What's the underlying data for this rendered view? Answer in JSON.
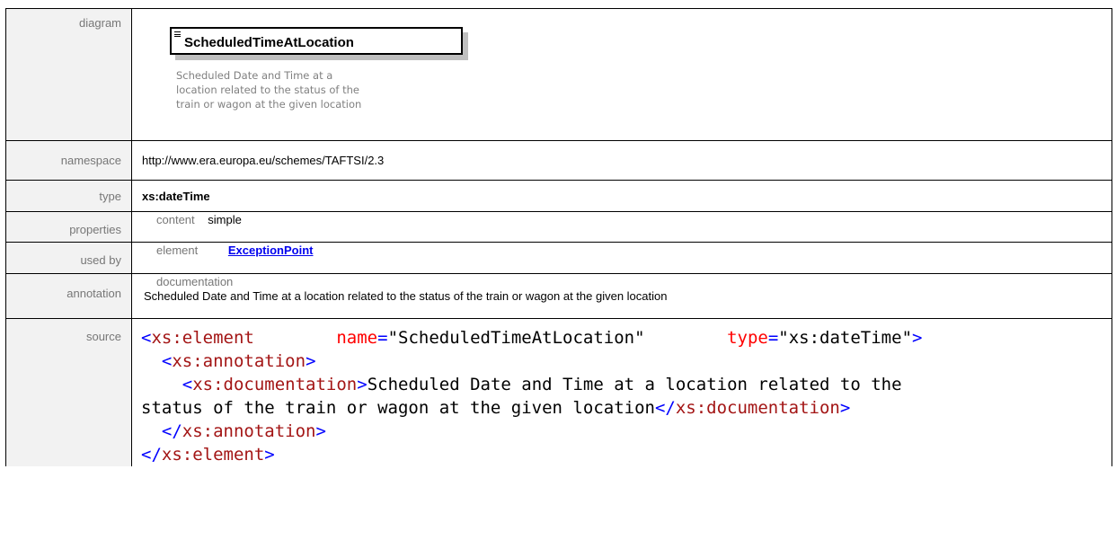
{
  "rows": {
    "diagram": {
      "label": "diagram",
      "element_name": "ScheduledTimeAtLocation",
      "doc_line1": "Scheduled Date and Time at a",
      "doc_line2": "location related to the status of the",
      "doc_line3": "train or wagon at the given location"
    },
    "namespace": {
      "label": "namespace",
      "value": "http://www.era.europa.eu/schemes/TAFTSI/2.3"
    },
    "type": {
      "label": "type",
      "value": "xs:dateTime"
    },
    "properties": {
      "label": "properties",
      "key": "content",
      "value": "simple"
    },
    "used_by": {
      "label": "used by",
      "key": "element",
      "link": "ExceptionPoint"
    },
    "annotation": {
      "label": "annotation",
      "key": "documentation",
      "text": "Scheduled Date and Time at a location related to the status of the train or wagon at the given location"
    },
    "source": {
      "label": "source",
      "open_tag": "xs:element",
      "name_attr": "name",
      "name_value": "\"ScheduledTimeAtLocation\"",
      "type_attr": "type",
      "type_value": "\"xs:dateTime\"",
      "annotation_tag": "xs:annotation",
      "documentation_tag": "xs:documentation",
      "doc_part1": "Scheduled Date and Time at a location related to the",
      "doc_part2": "status of the train or wagon at the given location"
    }
  }
}
